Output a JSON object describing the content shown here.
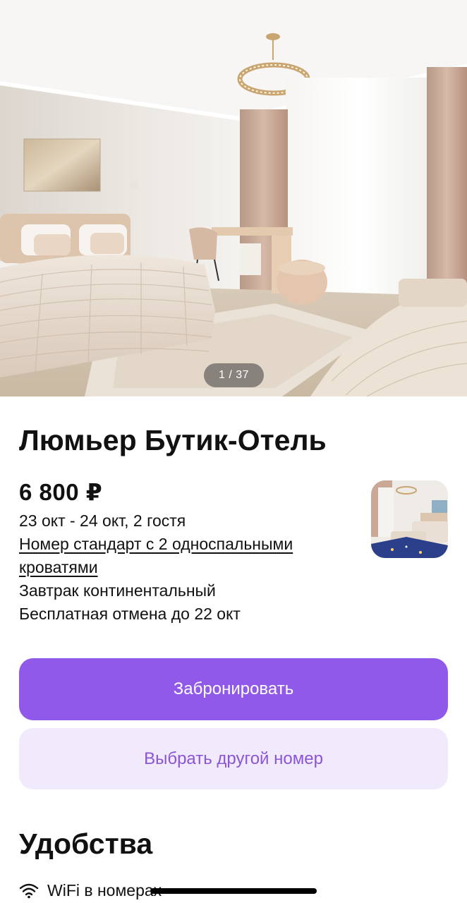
{
  "gallery": {
    "counter": "1 / 37"
  },
  "hotel": {
    "title": "Люмьер Бутик-Отель"
  },
  "offer": {
    "price": "6 800 ₽",
    "dates_guests": "23 окт - 24 окт, 2 гостя",
    "room_link": "Номер стандарт с 2 односпальными кроватями",
    "meal": "Завтрак континентальный",
    "cancellation": "Бесплатная отмена до 22 окт"
  },
  "actions": {
    "book_label": "Забронировать",
    "other_room_label": "Выбрать другой номер"
  },
  "amenities": {
    "title": "Удобства",
    "items": [
      {
        "icon": "wifi-icon",
        "label": "WiFi в номерах"
      }
    ]
  },
  "colors": {
    "primary": "#9159ea",
    "secondary_bg": "#f1eafd",
    "secondary_text": "#8a55d6"
  }
}
